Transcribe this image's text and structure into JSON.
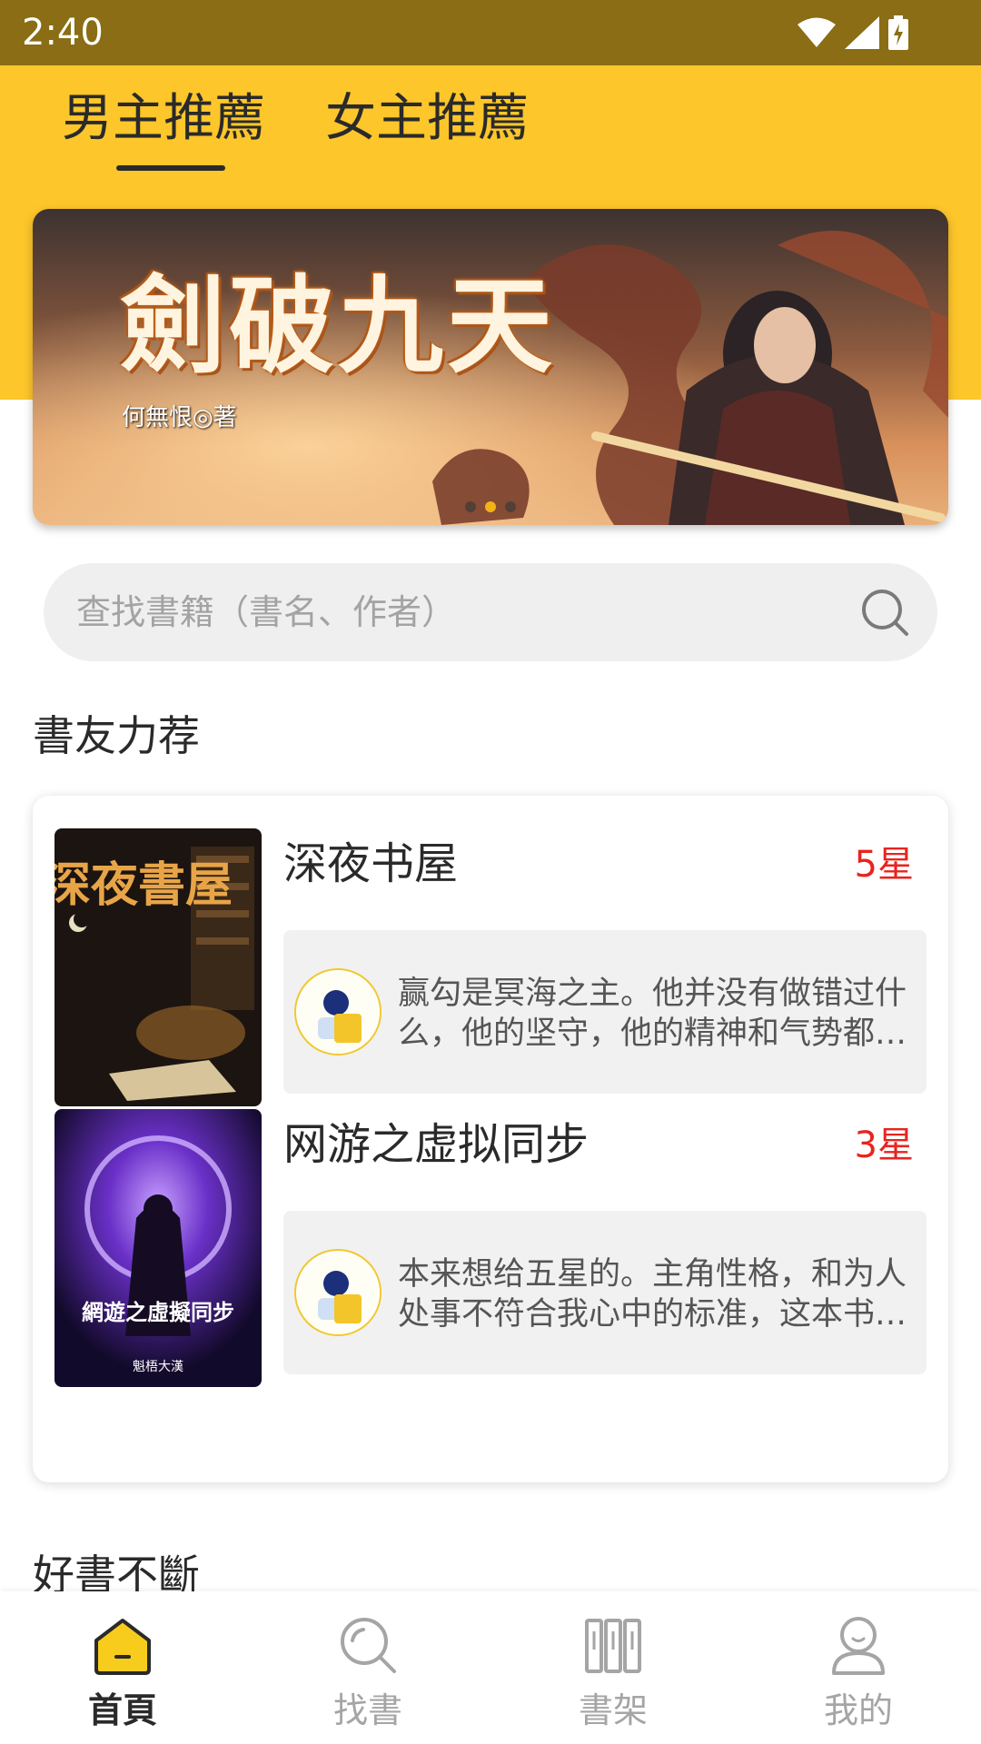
{
  "status_bar": {
    "time": "2:40",
    "icons": [
      "wifi-icon",
      "signal-icon",
      "battery-icon"
    ]
  },
  "tabs": [
    {
      "label": "男主推薦",
      "active": true
    },
    {
      "label": "女主推薦",
      "active": false
    }
  ],
  "banner": {
    "title": "劍破九天",
    "author": "何無恨◎著",
    "page_count": 3,
    "active_page": 1
  },
  "search": {
    "placeholder": "查找書籍（書名、作者）",
    "icon": "search-icon"
  },
  "recommend": {
    "title": "書友力荐",
    "books": [
      {
        "title": "深夜书屋",
        "rating": "5星",
        "cover_title": "深夜書屋",
        "review": "赢勾是冥海之主。他并没有做错过什么，他的坚守，他的精神和气势都值得敬佩。"
      },
      {
        "title": "网游之虚拟同步",
        "rating": "3星",
        "cover_title": "網遊之虛擬同步",
        "cover_author": "魁梧大漢",
        "review": "本来想给五星的。主角性格，和为人处事不符合我心中的标准，这本书依然值得一看。"
      }
    ]
  },
  "good_books": {
    "title": "好書不斷"
  },
  "nav": [
    {
      "label": "首頁",
      "icon": "home-icon",
      "active": true
    },
    {
      "label": "找書",
      "icon": "search-icon",
      "active": false
    },
    {
      "label": "書架",
      "icon": "bookshelf-icon",
      "active": false
    },
    {
      "label": "我的",
      "icon": "profile-icon",
      "active": false
    }
  ],
  "colors": {
    "accent": "#fdc62a",
    "status_bar": "#8a6d14",
    "rating": "#e8241f"
  }
}
